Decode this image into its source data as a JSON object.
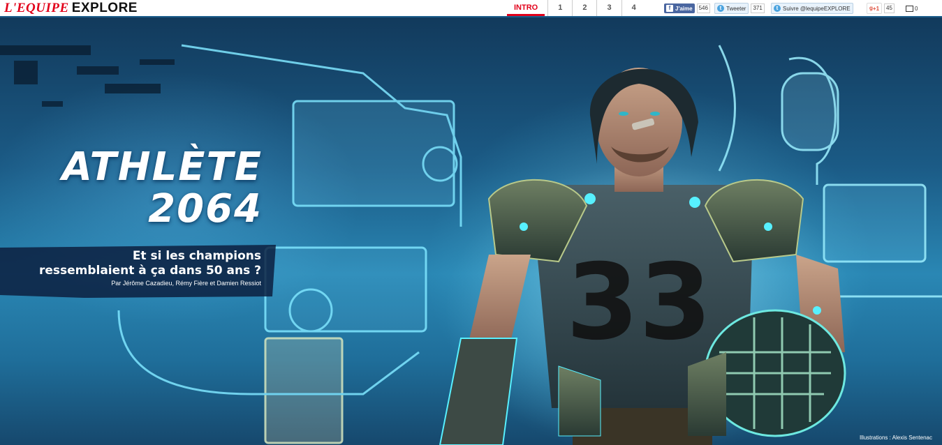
{
  "header": {
    "logo_part1": "L'EQUIPE",
    "logo_part2": "EXPLORE",
    "nav": [
      {
        "label": "INTRO",
        "active": true
      },
      {
        "label": "1",
        "active": false
      },
      {
        "label": "2",
        "active": false
      },
      {
        "label": "3",
        "active": false
      },
      {
        "label": "4",
        "active": false
      }
    ],
    "social": {
      "facebook_label": "J'aime",
      "facebook_count": "546",
      "tweet_label": "Tweeter",
      "tweet_count": "371",
      "follow_label": "Suivre @lequipeEXPLORE",
      "gplus_label": "+1",
      "gplus_count": "45",
      "comments_count": "0"
    }
  },
  "hero": {
    "title_line1": "ATHLÈTE",
    "title_line2": "2064",
    "subtitle_line1": "Et si les champions",
    "subtitle_line2": "ressemblaient à ça dans 50 ans ?",
    "byline": "Par Jérôme Cazadieu, Rémy Fière et Damien Ressiot",
    "credit": "Illustrations : Alexis Sentenac",
    "jersey_number": "33"
  },
  "colors": {
    "brand_red": "#e2001a",
    "facebook": "#4a66a0",
    "twitter": "#4aa3df",
    "gplus": "#dd4b39"
  }
}
